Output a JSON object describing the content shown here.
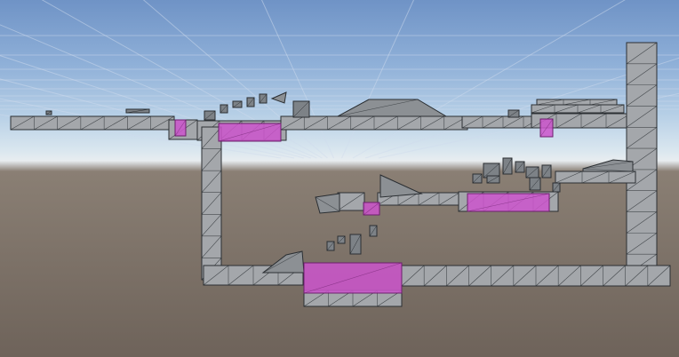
{
  "scene": {
    "view": "perspective-scene-view",
    "colors": {
      "sky_top": "#6f93c6",
      "horizon": "#e8edf0",
      "ground": "#6e635a",
      "grid_line": "#d0dced",
      "block_fill": "#a4a7ab",
      "block_edge": "#2b2f33",
      "hazard_fill": "#cc55cc",
      "hazard_edge": "#6d1f6d",
      "rock_fill": "#8c9094"
    },
    "objects": {
      "platforms": 14,
      "pink_hazards": 6,
      "floating_blocks": 22,
      "ramps": 4
    }
  }
}
